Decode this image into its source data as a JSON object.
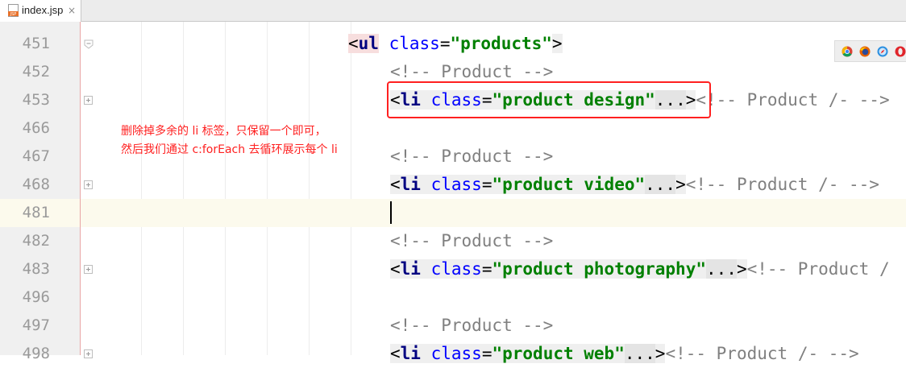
{
  "tab": {
    "icon": "jsp-file-icon",
    "icon_label": "JSP",
    "label": "index.jsp",
    "close": "×"
  },
  "line_numbers": [
    "451",
    "452",
    "453",
    "466",
    "467",
    "468",
    "481",
    "482",
    "483",
    "496",
    "497",
    "498"
  ],
  "code": {
    "l451": {
      "open": "<",
      "tag": "ul",
      "attr": "class",
      "eq": "=",
      "value": "\"products\"",
      "close": ">"
    },
    "l452": {
      "comment": "<!-- Product -->"
    },
    "l453": {
      "open": "<",
      "tag": "li",
      "attr": "class",
      "eq": "=",
      "value": "\"product design\"",
      "folded": "...",
      "close": ">",
      "trail": "<!-- Product /- -->"
    },
    "l467": {
      "comment": "<!-- Product -->"
    },
    "l468": {
      "open": "<",
      "tag": "li",
      "attr": "class",
      "eq": "=",
      "value": "\"product video\"",
      "folded": "...",
      "close": ">",
      "trail": "<!-- Product /- -->"
    },
    "l482": {
      "comment": "<!-- Product -->"
    },
    "l483": {
      "open": "<",
      "tag": "li",
      "attr": "class",
      "eq": "=",
      "value": "\"product photography\"",
      "folded": "...",
      "close": ">",
      "trail": "<!-- Product /"
    },
    "l497": {
      "comment": "<!-- Product -->"
    },
    "l498": {
      "open": "<",
      "tag": "li",
      "attr": "class",
      "eq": "=",
      "value": "\"product web\"",
      "folded": "...",
      "close": ">",
      "trail": "<!-- Product /- -->"
    }
  },
  "annotation": {
    "line1": "删除掉多余的 li 标签，只保留一个即可，",
    "line2": "然后我们通过 c:forEach 去循环展示每个 li"
  },
  "browser_icons": [
    "chrome-icon",
    "firefox-icon",
    "safari-icon",
    "opera-icon"
  ],
  "colors": {
    "annotation": "#ff2020",
    "current_line": "#fcfaed",
    "gutter": "#f0f0f0"
  }
}
